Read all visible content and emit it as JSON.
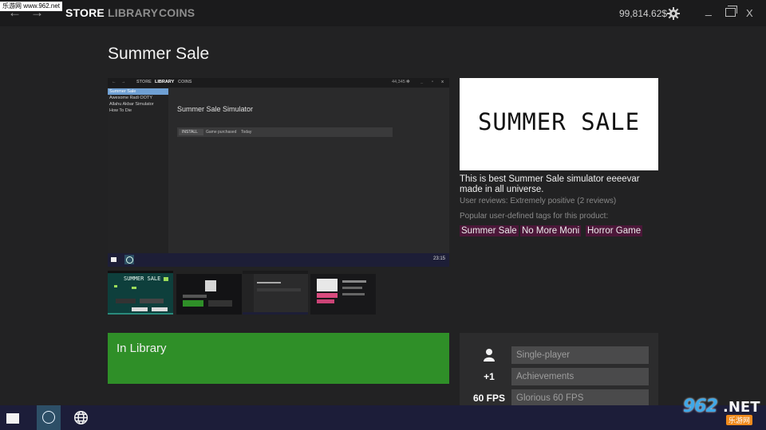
{
  "watermark_top": "乐游网 www.962.net",
  "nav": {
    "back": "←",
    "forward": "→",
    "tabs": [
      {
        "label": "STORE",
        "active": true
      },
      {
        "label": "LIBRARY",
        "active": false
      },
      {
        "label": "COINS",
        "active": false
      }
    ],
    "balance": "99,814.62$",
    "settings_icon": "gear-icon",
    "window": {
      "minimize": "_",
      "close": "X"
    }
  },
  "page_title": "Summer Sale",
  "main_screenshot": {
    "nav": {
      "back": "←",
      "forward": "→",
      "store": "STORE",
      "library": "LIBRARY",
      "coins": "COINS",
      "balance": "44,345"
    },
    "sidebar_items": [
      "Summer Sale",
      "Awesome Radi OOTY",
      "Allahu Akbar Simulator",
      "How To Die"
    ],
    "game_title": "Summer Sale Simulator",
    "install_bar": {
      "button": "INSTALL",
      "status": "Game purchased",
      "date": "Today"
    },
    "clock": "23:15"
  },
  "thumbnails": [
    {
      "label": "SUMMER SALE"
    },
    {
      "label": ""
    },
    {
      "label": ""
    },
    {
      "label": ""
    }
  ],
  "banner": {
    "text": "SUMMER SALE"
  },
  "description": "This is best Summer Sale simulator eeeevar made in all universe.",
  "reviews": "User reviews: Extremely positive (2 reviews)",
  "tags_label": "Popular user-defined tags for this product:",
  "tags": [
    "Summer Sale",
    "No More Moni",
    "Horror Game"
  ],
  "library_status": "In Library",
  "features": [
    {
      "icon": "person-icon",
      "icon_text": "",
      "label": "Single-player"
    },
    {
      "icon": "plus-one-icon",
      "icon_text": "+1",
      "label": "Achievements"
    },
    {
      "icon": "fps-icon",
      "icon_text": "60 FPS",
      "label": "Glorious 60 FPS"
    }
  ],
  "site_logo": {
    "number": "962",
    "domain": ".NET",
    "chinese": "乐游网"
  },
  "colors": {
    "library_green": "#2f8f28",
    "tag_bg": "#4c1739",
    "taskbar": "#1c1d39",
    "accent_blue": "#6fa0d4"
  }
}
